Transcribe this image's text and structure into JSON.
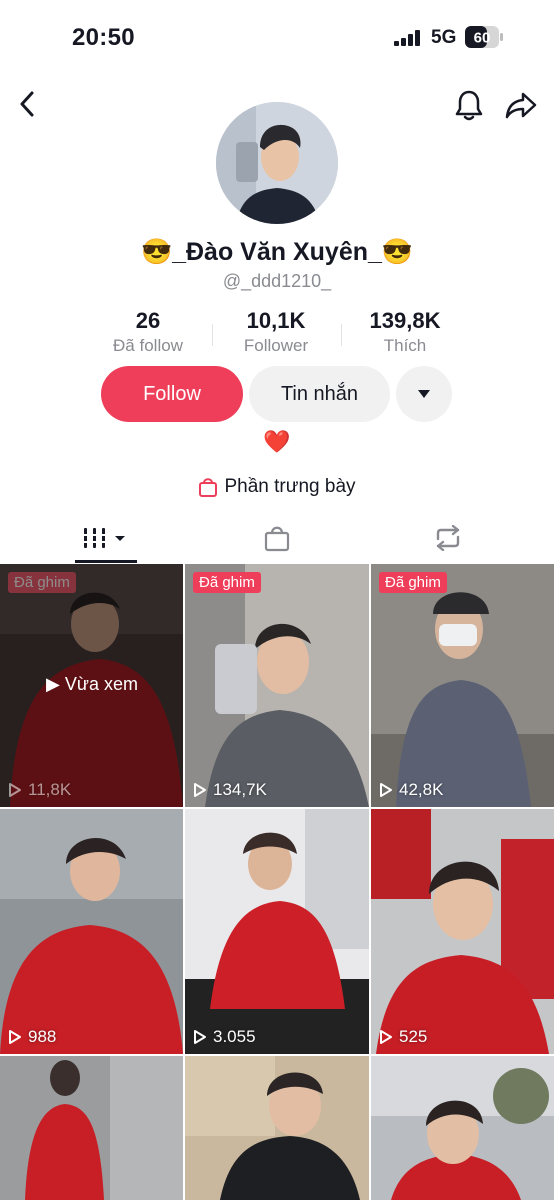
{
  "status_bar": {
    "time": "20:50",
    "network": "5G",
    "battery": "60"
  },
  "profile": {
    "display_name": "😎_Đào Văn Xuyên_😎",
    "handle": "@_ddd1210_",
    "stats": [
      {
        "value": "26",
        "label": "Đã follow"
      },
      {
        "value": "10,1K",
        "label": "Follower"
      },
      {
        "value": "139,8K",
        "label": "Thích"
      }
    ],
    "bio": "❤️",
    "showcase_label": "Phần trưng bày"
  },
  "actions": {
    "follow": "Follow",
    "message": "Tin nhắn"
  },
  "colors": {
    "accent": "#ef3e59",
    "button_gray": "#f1f1f2",
    "muted_text": "#8a8b91"
  },
  "tabs": [
    "videos-grid-icon",
    "bag-icon",
    "repost-icon"
  ],
  "videos": [
    {
      "pinned": "Đã ghim",
      "views": "11,8K",
      "overlay": "Vừa xem"
    },
    {
      "pinned": "Đã ghim",
      "views": "134,7K"
    },
    {
      "pinned": "Đã ghim",
      "views": "42,8K"
    },
    {
      "views": "988"
    },
    {
      "views": "3.055"
    },
    {
      "views": "525"
    },
    {
      "views": ""
    },
    {
      "views": ""
    },
    {
      "views": ""
    }
  ]
}
